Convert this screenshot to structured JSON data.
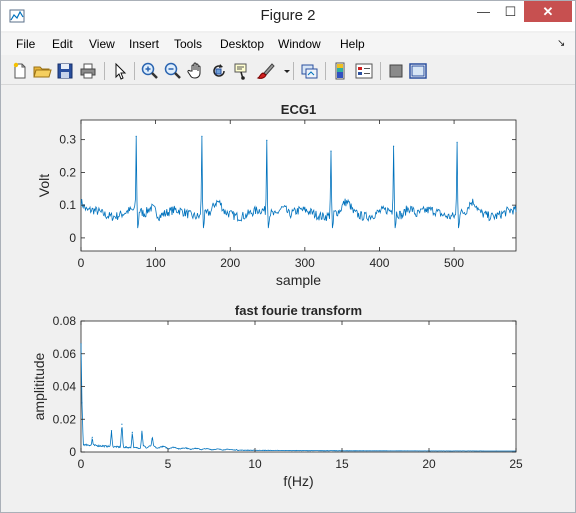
{
  "window": {
    "title": "Figure 2",
    "minimize": "—",
    "maximize": "☐",
    "close": "✕"
  },
  "menu": [
    "File",
    "Edit",
    "View",
    "Insert",
    "Tools",
    "Desktop",
    "Window",
    "Help"
  ],
  "toolbar_icons": [
    "new-figure-icon",
    "open-file-icon",
    "save-icon",
    "print-icon",
    "edit-plot-arrow-icon",
    "zoom-in-icon",
    "zoom-out-icon",
    "pan-hand-icon",
    "rotate-3d-icon",
    "data-cursor-icon",
    "brush-icon",
    "link-plot-icon",
    "colorbar-icon",
    "legend-icon",
    "hide-plot-tools-icon",
    "show-plot-tools-icon"
  ],
  "colors": {
    "line": "#0072bd",
    "axes_bg": "#ffffff",
    "figure_bg": "#f0f0f0",
    "axis": "#262626"
  },
  "chart_data": [
    {
      "type": "line",
      "title": "ECG1",
      "xlabel": "sample",
      "ylabel": "Volt",
      "xlim": [
        0,
        583
      ],
      "ylim": [
        -0.04,
        0.36
      ],
      "xticks": [
        0,
        100,
        200,
        300,
        400,
        500
      ],
      "yticks": [
        0,
        0.1,
        0.2,
        0.3
      ],
      "xtick_labels": [
        "0",
        "100",
        "200",
        "300",
        "400",
        "500"
      ],
      "ytick_labels": [
        "0",
        "0.1",
        "0.2",
        "0.3"
      ],
      "baseline": 0.075,
      "r_peaks": [
        {
          "x": 74,
          "y": 0.31
        },
        {
          "x": 162,
          "y": 0.31
        },
        {
          "x": 249,
          "y": 0.298
        },
        {
          "x": 335,
          "y": 0.265
        },
        {
          "x": 419,
          "y": 0.28
        },
        {
          "x": 504,
          "y": 0.292
        }
      ],
      "grid": false
    },
    {
      "type": "line",
      "title": "fast fourie transform",
      "xlabel": "f(Hz)",
      "ylabel": "amplititude",
      "xlim": [
        0,
        25
      ],
      "ylim": [
        0,
        0.08
      ],
      "xticks": [
        0,
        5,
        10,
        15,
        20,
        25
      ],
      "yticks": [
        0,
        0.02,
        0.04,
        0.06,
        0.08
      ],
      "xtick_labels": [
        "0",
        "5",
        "10",
        "15",
        "20",
        "25"
      ],
      "ytick_labels": [
        "0",
        "0.02",
        "0.04",
        "0.06",
        "0.08"
      ],
      "peaks": [
        {
          "x": 0.0,
          "y": 0.066
        },
        {
          "x": 0.05,
          "y": 0.03
        },
        {
          "x": 0.65,
          "y": 0.009
        },
        {
          "x": 1.75,
          "y": 0.013
        },
        {
          "x": 2.35,
          "y": 0.017
        },
        {
          "x": 2.95,
          "y": 0.012
        },
        {
          "x": 3.5,
          "y": 0.011
        },
        {
          "x": 4.1,
          "y": 0.008
        }
      ],
      "grid": false
    }
  ]
}
